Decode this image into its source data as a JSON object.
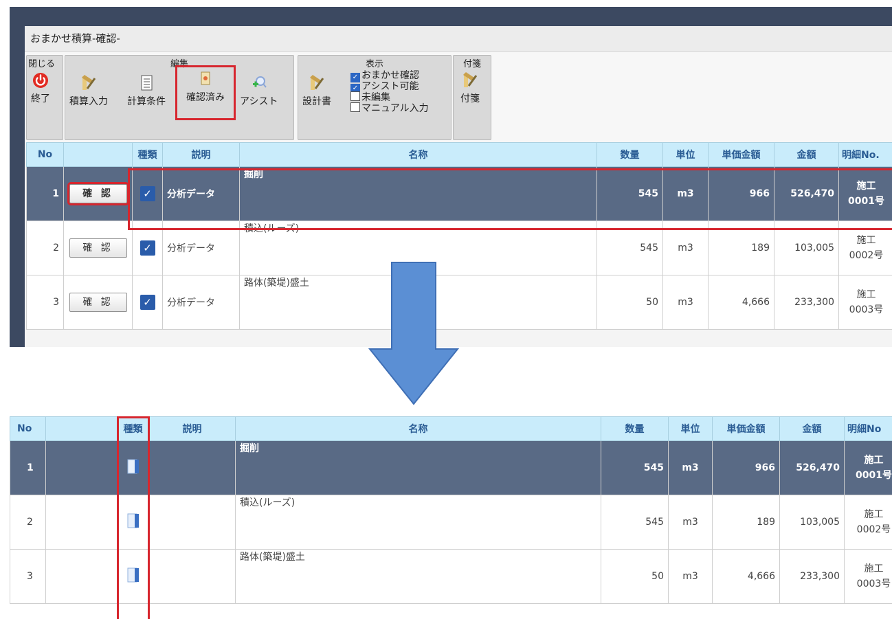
{
  "window": {
    "title": "おまかせ積算-確認-"
  },
  "ribbon": {
    "close_group": {
      "title": "閉じる",
      "end_label": "終了"
    },
    "edit_group": {
      "title": "編集",
      "buttons": [
        "積算入力",
        "計算条件",
        "確認済み",
        "アシスト"
      ]
    },
    "view_group": {
      "title": "表示",
      "design_label": "設計書",
      "checks": [
        {
          "label": "おまかせ確認",
          "checked": true
        },
        {
          "label": "アシスト可能",
          "checked": true
        },
        {
          "label": "未編集",
          "checked": false
        },
        {
          "label": "マニュアル入力",
          "checked": false
        }
      ]
    },
    "tag_group": {
      "title": "付箋",
      "label": "付箋"
    }
  },
  "grid_top": {
    "headers": [
      "No",
      "",
      "種類",
      "説明",
      "名称",
      "数量",
      "単位",
      "単価金額",
      "金額",
      "明細No."
    ],
    "confirm_label": "確 認",
    "rows": [
      {
        "no": "1",
        "desc": "分析データ",
        "name": "掘削",
        "qty": "545",
        "unit": "m3",
        "price": "966",
        "amount": "526,470",
        "detail1": "施工",
        "detail2": "0001号"
      },
      {
        "no": "2",
        "desc": "分析データ",
        "name": "積込(ルーズ)",
        "qty": "545",
        "unit": "m3",
        "price": "189",
        "amount": "103,005",
        "detail1": "施工",
        "detail2": "0002号"
      },
      {
        "no": "3",
        "desc": "分析データ",
        "name": "路体(築堤)盛土",
        "qty": "50",
        "unit": "m3",
        "price": "4,666",
        "amount": "233,300",
        "detail1": "施工",
        "detail2": "0003号"
      }
    ]
  },
  "grid_bottom": {
    "headers": [
      "No",
      "",
      "種類",
      "説明",
      "名称",
      "数量",
      "単位",
      "単価金額",
      "金額",
      "明細No"
    ],
    "rows": [
      {
        "no": "1",
        "name": "掘削",
        "qty": "545",
        "unit": "m3",
        "price": "966",
        "amount": "526,470",
        "detail1": "施工",
        "detail2": "0001号"
      },
      {
        "no": "2",
        "name": "積込(ルーズ)",
        "qty": "545",
        "unit": "m3",
        "price": "189",
        "amount": "103,005",
        "detail1": "施工",
        "detail2": "0002号"
      },
      {
        "no": "3",
        "name": "路体(築堤)盛土",
        "qty": "50",
        "unit": "m3",
        "price": "4,666",
        "amount": "233,300",
        "detail1": "施工",
        "detail2": "0003号"
      }
    ]
  },
  "colors": {
    "accent_red": "#d7262e",
    "selected_row": "#596a85",
    "header_bg": "#c9ecfb",
    "arrow": "#5b8fd4"
  },
  "icons": [
    "power-icon",
    "pencil-icon",
    "document-icon",
    "confirm-doc-icon",
    "assist-magnifier-icon",
    "design-pencil-icon",
    "tag-pencil-icon",
    "checkmark-icon",
    "book-icon",
    "down-arrow-icon"
  ]
}
